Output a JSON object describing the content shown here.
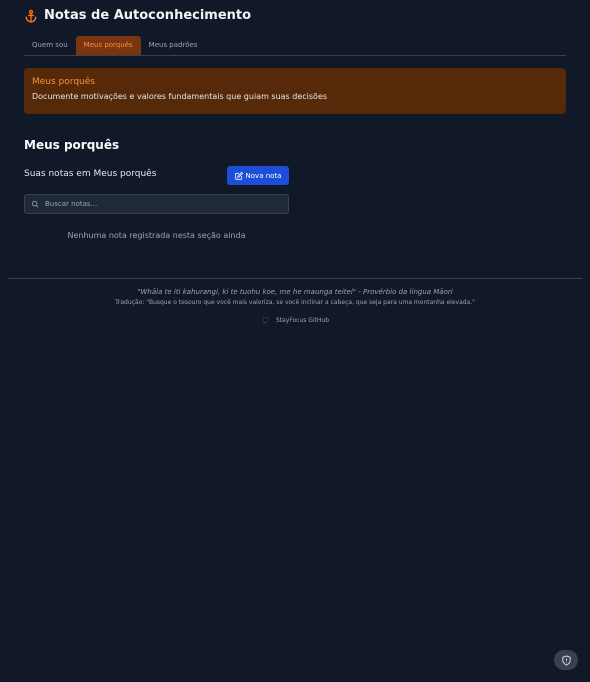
{
  "header": {
    "title": "Notas de Autoconhecimento",
    "icon": "anchor-icon",
    "accent": "#f97316"
  },
  "tabs": [
    {
      "label": "Quem sou",
      "active": false
    },
    {
      "label": "Meus porquês",
      "active": true
    },
    {
      "label": "Meus padrões",
      "active": false
    }
  ],
  "banner": {
    "title": "Meus porquês",
    "description": "Documente motivações e valores fundamentais que guiam suas decisões"
  },
  "section": {
    "title": "Meus porquês",
    "subtitle": "Suas notas em Meus porquês",
    "new_button": "Nova nota",
    "search_placeholder": "Buscar notas...",
    "empty_text": "Nenhuma nota registrada nesta seção ainda"
  },
  "footer": {
    "quote": "\"Whāia te iti kahurangi, ki te tuohu koe, me he maunga teitei\" - Provérbio da língua Māori",
    "translation": "Tradução: \"Busque o tesouro que você mais valoriza, se você inclinar a cabeça, que seja para uma montanha elevada.\"",
    "github_label": "StayFocus GitHub"
  },
  "colors": {
    "background": "#111827",
    "banner": "#562a08",
    "primary_button": "#1d4ed8",
    "active_tab": "#78350f"
  }
}
